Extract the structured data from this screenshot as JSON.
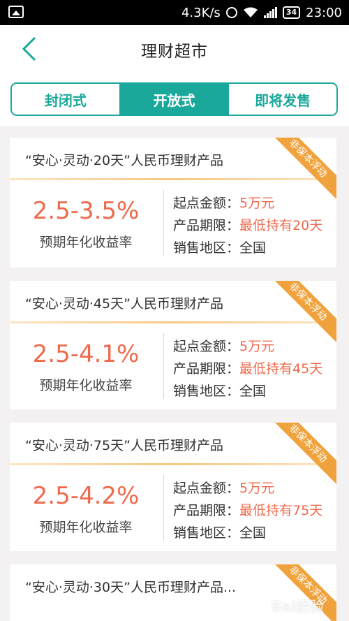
{
  "status_bar": {
    "network_speed": "4.3K/s",
    "battery": "34",
    "time": "23:00"
  },
  "header": {
    "title": "理财超市"
  },
  "tabs": [
    {
      "label": "封闭式",
      "active": false
    },
    {
      "label": "开放式",
      "active": true
    },
    {
      "label": "即将发售",
      "active": false
    }
  ],
  "products": [
    {
      "name": "“安心·灵动·20天”人民币理财产品",
      "badge": "非保本浮动",
      "rate": "2.5-3.5%",
      "rate_label": "预期年化收益率",
      "min_amount_label": "起点金额：",
      "min_amount": "5万元",
      "term_label": "产品期限：",
      "term": "最低持有20天",
      "region_label": "销售地区：",
      "region": "全国"
    },
    {
      "name": "“安心·灵动·45天”人民币理财产品",
      "badge": "非保本浮动",
      "rate": "2.5-4.1%",
      "rate_label": "预期年化收益率",
      "min_amount_label": "起点金额：",
      "min_amount": "5万元",
      "term_label": "产品期限：",
      "term": "最低持有45天",
      "region_label": "销售地区：",
      "region": "全国"
    },
    {
      "name": "“安心·灵动·75天”人民币理财产品",
      "badge": "非保本浮动",
      "rate": "2.5-4.2%",
      "rate_label": "预期年化收益率",
      "min_amount_label": "起点金额：",
      "min_amount": "5万元",
      "term_label": "产品期限：",
      "term": "最低持有75天",
      "region_label": "销售地区：",
      "region": "全国"
    },
    {
      "name": "“安心·灵动·30天”人民币理财产品...",
      "badge": "非保本浮动"
    }
  ],
  "watermark": "Bai经验",
  "colors": {
    "accent": "#1aa89a",
    "rate": "#ef6a4c",
    "badge": "#f0a23c"
  }
}
